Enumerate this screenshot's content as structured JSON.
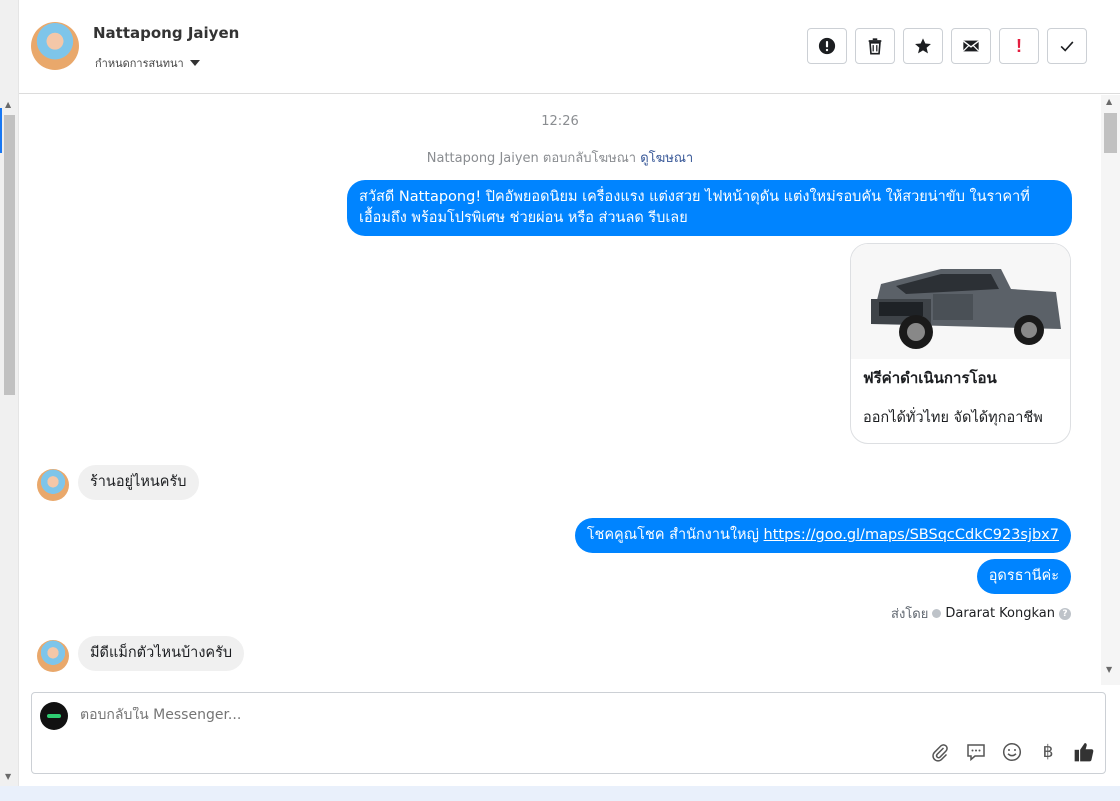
{
  "contact": {
    "name": "Nattapong Jaiyen",
    "assign_label": "กำหนดการสนทนา"
  },
  "actions": [
    {
      "name": "spam-button",
      "icon": "exclamation-circle-icon"
    },
    {
      "name": "delete-button",
      "icon": "trash-icon"
    },
    {
      "name": "star-button",
      "icon": "star-icon"
    },
    {
      "name": "mark-unread-button",
      "icon": "envelope-icon"
    },
    {
      "name": "follow-up-button",
      "icon": "exclamation-icon",
      "glyph": "!"
    },
    {
      "name": "mark-done-button",
      "icon": "checkmark-icon"
    }
  ],
  "thread": {
    "timestamp": "12:26",
    "ad_reply_text": "Nattapong Jaiyen ตอบกลับโฆษณา",
    "ad_reply_link": "ดูโฆษณา",
    "messages": {
      "out_1": "สวัสดี Nattapong! ปิคอัพยอดนิยม เครื่องแรง แต่งสวย ไฟหน้าดุดัน แต่งใหม่รอบคัน ให้สวยน่าขับ ในราคาที่เอื้อมถึง พร้อมโปรพิเศษ ช่วยผ่อน หรือ ส่วนลด รีบเลย",
      "card_title": "ฟรีค่าดำเนินการโอน",
      "card_sub": "ออกได้ทั่วไทย จัดได้ทุกอาชีพ",
      "in_1": "ร้านอยู่ไหนครับ",
      "out_2_text": "โชคคูณโชค สำนักงานใหญ่ ",
      "out_2_link": "https://goo.gl/maps/SBSqcCdkC923sjbx7",
      "out_3": "อุดรธานีค่ะ",
      "in_2": "มีดีแม็กตัวไหนบ้างครับ"
    },
    "sent_by_label": "ส่งโดย",
    "sent_by_name": "Dararat Kongkan"
  },
  "composer": {
    "placeholder": "ตอบกลับใน Messenger...",
    "tools": [
      "paperclip-icon",
      "chat-bubble-icon",
      "smiley-icon",
      "baht-icon",
      "thumbs-up-icon"
    ],
    "baht_glyph": "฿"
  },
  "colors": {
    "outgoing_bubble": "#0084ff",
    "incoming_bubble": "#f0f0f0",
    "link": "#385898",
    "follow_up_red": "#e41e3f"
  }
}
